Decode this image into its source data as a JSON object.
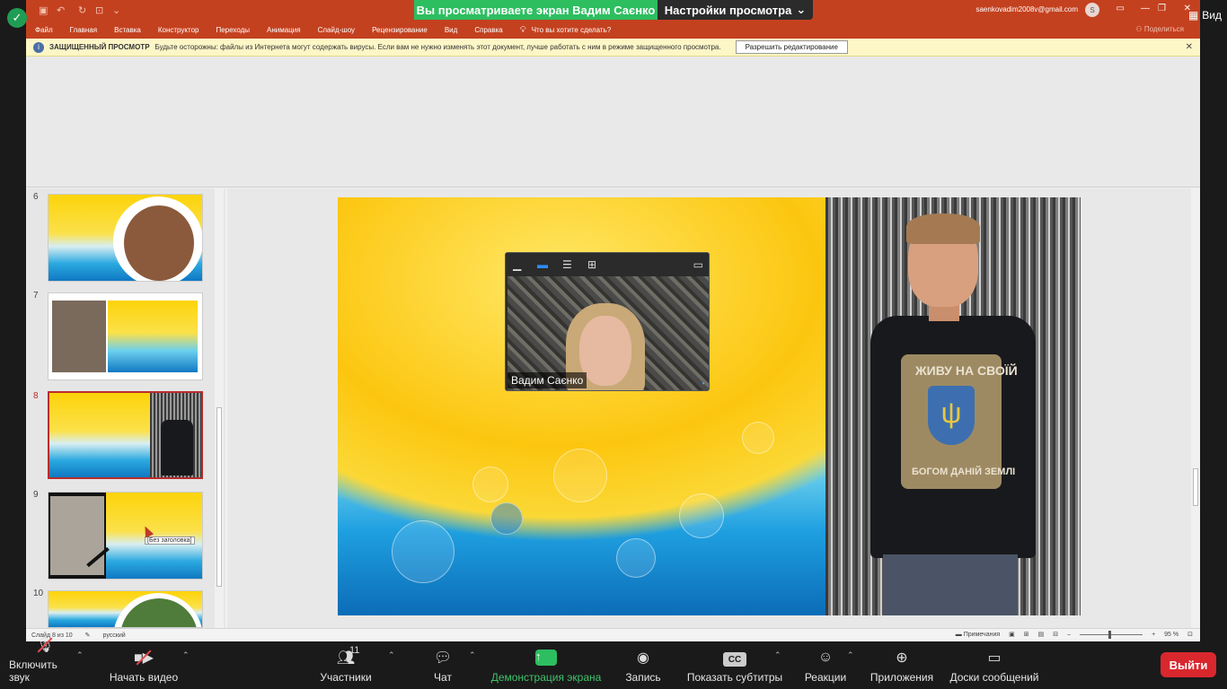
{
  "zoom": {
    "share_banner": "Вы просматриваете экран Вадим Саєнко",
    "view_options": "Настройки просмотра",
    "view_label": "Вид",
    "video_name": "Вадим Саєнко",
    "toolbar": {
      "mute": "Включить звук",
      "video": "Начать видео",
      "participants": "Участники",
      "participants_count": "11",
      "chat": "Чат",
      "share": "Демонстрация экрана",
      "record": "Запись",
      "captions": "Показать субтитры",
      "reactions": "Реакции",
      "apps": "Приложения",
      "whiteboards": "Доски сообщений",
      "leave": "Выйти"
    },
    "colors": {
      "share_green": "#2dbe60",
      "leave_red": "#d9272e"
    }
  },
  "ppt": {
    "menu": [
      "Файл",
      "Главная",
      "Вставка",
      "Конструктор",
      "Переходы",
      "Анимация",
      "Слайд-шоу",
      "Рецензирование",
      "Вид",
      "Справка"
    ],
    "tell_me": "Что вы хотите сделать?",
    "share": "Поделиться",
    "email": "saenkovadim2008v@gmail.com",
    "avatar_letter": "S",
    "protected": {
      "title": "ЗАЩИЩЕННЫЙ ПРОСМОТР",
      "message": "Будьте осторожны: файлы из Интернета могут содержать вирусы. Если вам не нужно изменять этот документ, лучше работать с ним в режиме защищенного просмотра.",
      "button": "Разрешить редактирование"
    },
    "thumbnails": [
      {
        "num": "6"
      },
      {
        "num": "7"
      },
      {
        "num": "8",
        "active": true
      },
      {
        "num": "9"
      },
      {
        "num": "10"
      }
    ],
    "tooltip": "[Без заголовка]",
    "slide_print": {
      "top": "ЖИВУ НА СВОЇЙ",
      "bottom": "БОГОМ ДАНІЙ ЗЕМЛІ"
    },
    "status": {
      "slide": "Слайд 8 из 10",
      "language": "русский",
      "notes": "Примечания",
      "zoom": "95 %"
    },
    "colors": {
      "title_bar": "#c4411f",
      "protected_bar": "#fdf6c7",
      "active_thumb": "#b82d2d"
    }
  }
}
